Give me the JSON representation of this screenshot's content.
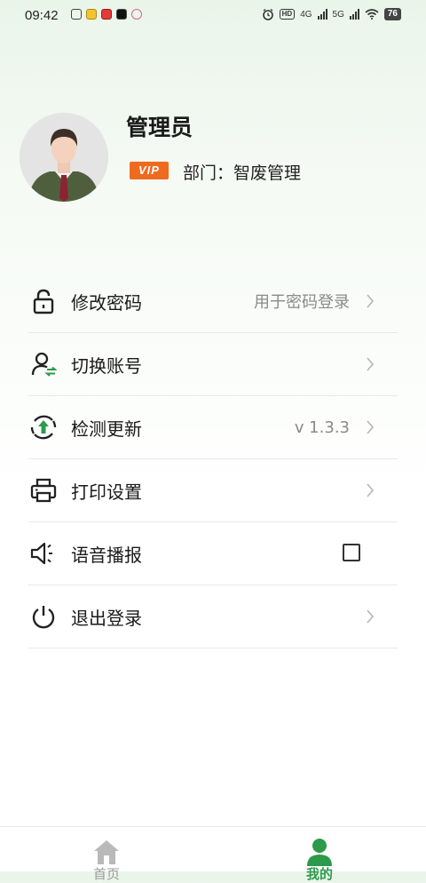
{
  "status_bar": {
    "time": "09:42",
    "hd": "HD",
    "net1": "4G",
    "net2": "5G",
    "battery": "76"
  },
  "profile": {
    "name": "管理员",
    "badge": "VIP",
    "department": "部门：智废管理"
  },
  "menu": [
    {
      "label": "修改密码",
      "value": "用于密码登录",
      "icon": "lock-icon",
      "control": "chevron"
    },
    {
      "label": "切换账号",
      "value": "",
      "icon": "switch-user-icon",
      "control": "chevron"
    },
    {
      "label": "检测更新",
      "value": "v 1.3.3",
      "icon": "update-icon",
      "control": "chevron"
    },
    {
      "label": "打印设置",
      "value": "",
      "icon": "printer-icon",
      "control": "chevron"
    },
    {
      "label": "语音播报",
      "value": "",
      "icon": "speaker-icon",
      "control": "checkbox",
      "checked": false
    },
    {
      "label": "退出登录",
      "value": "",
      "icon": "power-icon",
      "control": "chevron"
    }
  ],
  "bottom_nav": {
    "home_label": "首页",
    "mine_label": "我的",
    "active": "mine",
    "active_color": "#2c9a4b"
  }
}
